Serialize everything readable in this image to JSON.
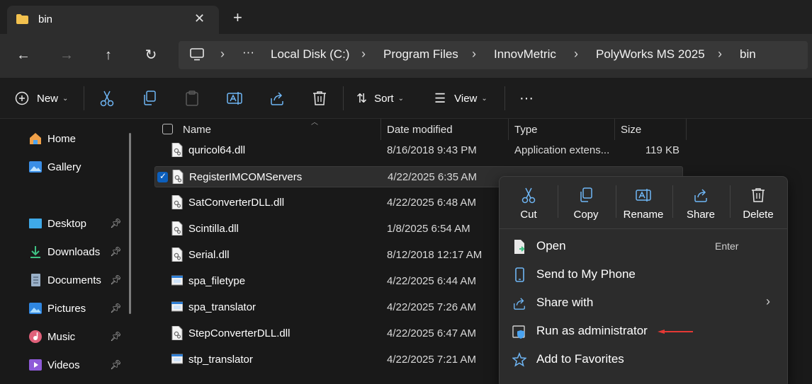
{
  "tab": {
    "title": "bin",
    "close": "✕",
    "new": "+"
  },
  "address": {
    "more": "···",
    "crumbs": [
      "Local Disk (C:)",
      "Program Files",
      "InnovMetric",
      "PolyWorks MS 2025",
      "bin"
    ]
  },
  "toolbar": {
    "new_label": "New",
    "sort_label": "Sort",
    "view_label": "View",
    "more": "···"
  },
  "sidebar": {
    "items": [
      {
        "label": "Home",
        "icon": "home-icon"
      },
      {
        "label": "Gallery",
        "icon": "gallery-icon"
      },
      {
        "label": "Desktop",
        "icon": "desktop-icon"
      },
      {
        "label": "Downloads",
        "icon": "downloads-icon"
      },
      {
        "label": "Documents",
        "icon": "documents-icon"
      },
      {
        "label": "Pictures",
        "icon": "pictures-icon"
      },
      {
        "label": "Music",
        "icon": "music-icon"
      },
      {
        "label": "Videos",
        "icon": "videos-icon"
      }
    ]
  },
  "columns": {
    "name": "Name",
    "date": "Date modified",
    "type": "Type",
    "size": "Size"
  },
  "files": [
    {
      "name": "quricol64.dll",
      "date": "8/16/2018 9:43 PM",
      "type": "Application extens...",
      "size": "119 KB"
    },
    {
      "name": "RegisterIMCOMServers",
      "date": "4/22/2025 6:35 AM",
      "type": "",
      "size": ""
    },
    {
      "name": "SatConverterDLL.dll",
      "date": "4/22/2025 6:48 AM",
      "type": "",
      "size": ""
    },
    {
      "name": "Scintilla.dll",
      "date": "1/8/2025 6:54 AM",
      "type": "",
      "size": ""
    },
    {
      "name": "Serial.dll",
      "date": "8/12/2018 12:17 AM",
      "type": "",
      "size": ""
    },
    {
      "name": "spa_filetype",
      "date": "4/22/2025 6:44 AM",
      "type": "",
      "size": ""
    },
    {
      "name": "spa_translator",
      "date": "4/22/2025 7:26 AM",
      "type": "",
      "size": ""
    },
    {
      "name": "StepConverterDLL.dll",
      "date": "4/22/2025 6:47 AM",
      "type": "",
      "size": ""
    },
    {
      "name": "stp_translator",
      "date": "4/22/2025 7:21 AM",
      "type": "",
      "size": ""
    }
  ],
  "context_menu": {
    "quick_actions": [
      "Cut",
      "Copy",
      "Rename",
      "Share",
      "Delete"
    ],
    "items": [
      {
        "label": "Open",
        "accel": "Enter"
      },
      {
        "label": "Send to My Phone"
      },
      {
        "label": "Share with",
        "submenu": "›"
      },
      {
        "label": "Run as administrator"
      },
      {
        "label": "Add to Favorites"
      }
    ]
  },
  "colors": {
    "accent": "#0c5fbd",
    "folder": "#f2c14e",
    "annotation": "#e53935",
    "shield_blue": "#4aa3f0"
  }
}
